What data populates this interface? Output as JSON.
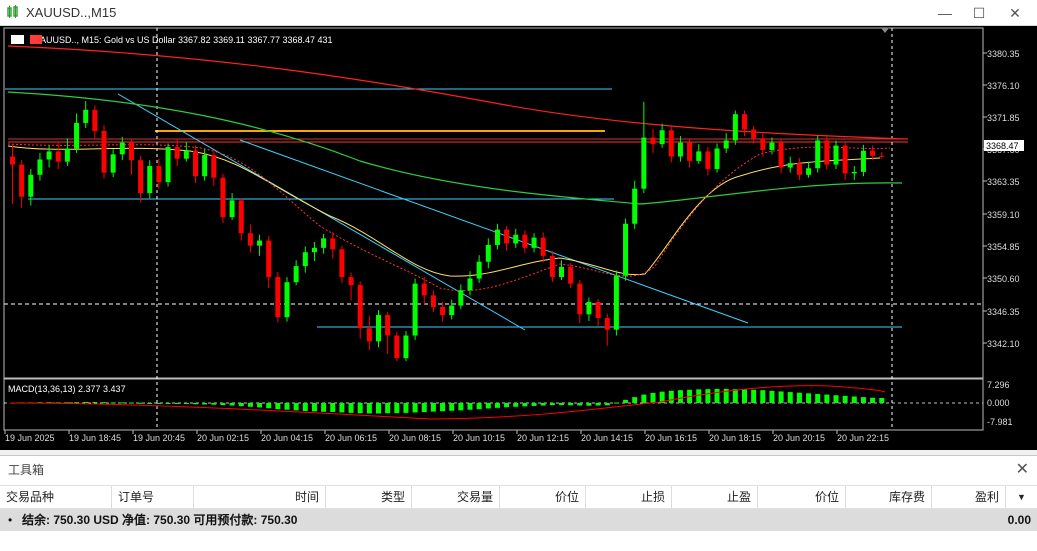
{
  "window": {
    "title": "XAUUSD..,M15",
    "minimize": "—",
    "maximize": "☐",
    "close": "✕"
  },
  "chart": {
    "header": "XAUUSD.., M15:  Gold vs US Dollar  3367.82 3369.11 3367.77 3368.47  431",
    "price_labels": [
      "3380.35",
      "3376.10",
      "3371.85",
      "3367.60",
      "3363.35",
      "3359.10",
      "3354.85",
      "3350.60",
      "3346.35",
      "3342.10"
    ],
    "current_price": "3368.47",
    "macd_label": "MACD(13,36,13) 2.377 3.437",
    "macd_levels": [
      "7.296",
      "0.000",
      "-7.981"
    ],
    "time_labels": [
      "19 Jun 2025",
      "19 Jun 18:45",
      "19 Jun 20:45",
      "20 Jun 02:15",
      "20 Jun 04:15",
      "20 Jun 06:15",
      "20 Jun 08:15",
      "20 Jun 10:15",
      "20 Jun 12:15",
      "20 Jun 14:15",
      "20 Jun 16:15",
      "20 Jun 18:15",
      "20 Jun 20:15",
      "20 Jun 22:15"
    ],
    "colors": {
      "bg": "#000000",
      "bull": "#00ff00",
      "bear": "#ff0000",
      "ma_slow": "#ff2020",
      "ma_mid": "#2ecc40",
      "ma_fast": "#ffe066",
      "ma_dotted": "#ff3333",
      "trend": "#40d0ff",
      "orange": "#ffa500",
      "macd_hist": "#00ff00",
      "macd_signal": "#ff0000"
    }
  },
  "toolbox": {
    "title": "工具箱",
    "close": "✕",
    "columns": [
      "交易品种",
      "订单号",
      "时间",
      "类型",
      "交易量",
      "价位",
      "止损",
      "止盈",
      "价位",
      "库存费",
      "盈利"
    ],
    "balance_text": "结余: 750.30 USD  净值: 750.30  可用预付款: 750.30",
    "profit": "0.00"
  }
}
